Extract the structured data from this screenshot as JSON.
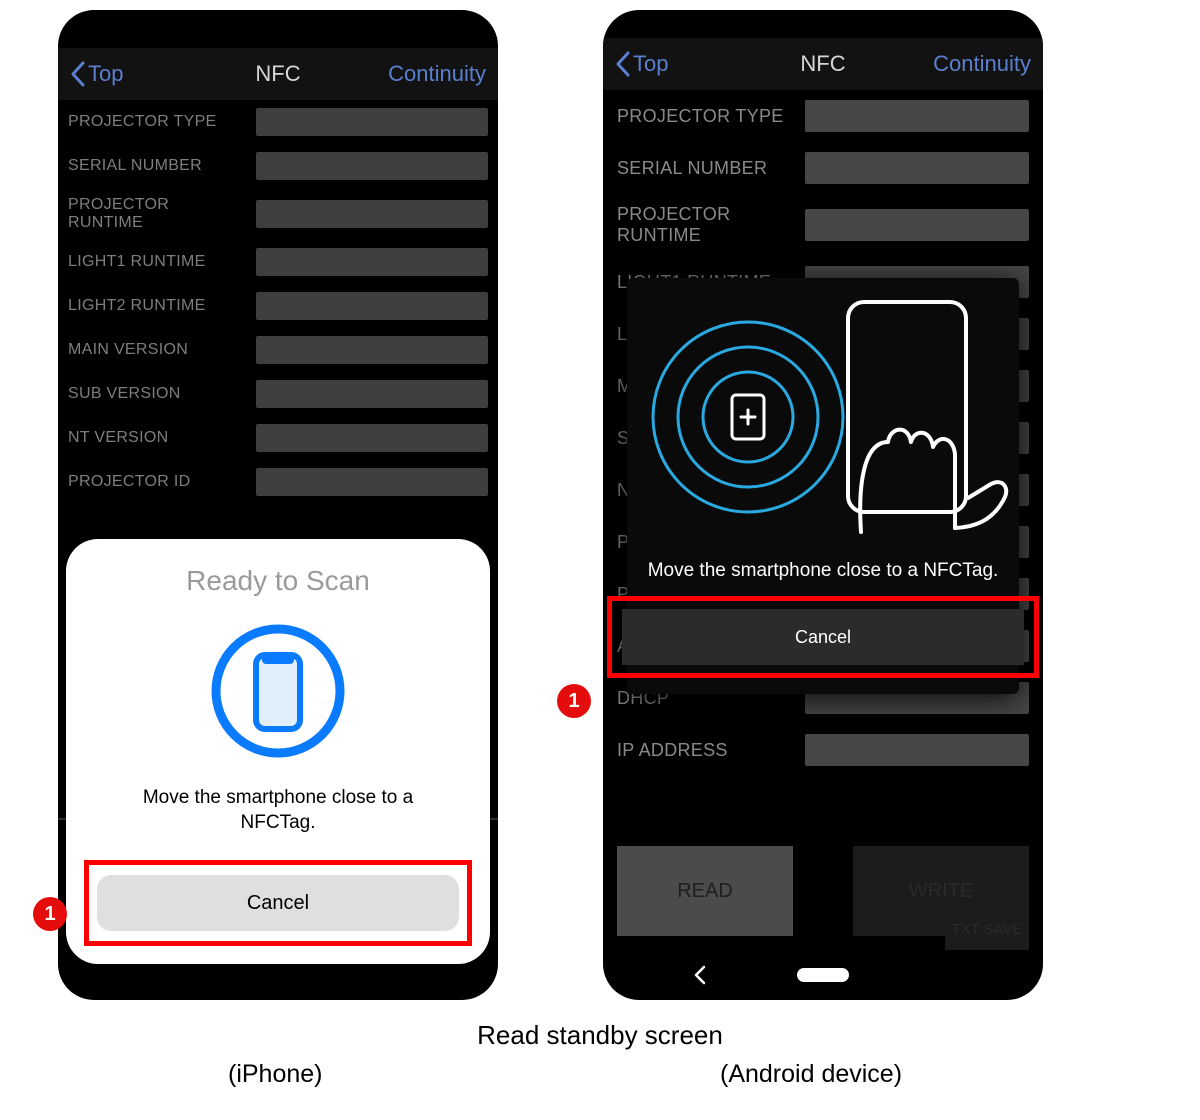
{
  "header": {
    "back_label": "Top",
    "title": "NFC",
    "right_link": "Continuity"
  },
  "fields": [
    "PROJECTOR TYPE",
    "SERIAL NUMBER",
    "PROJECTOR RUNTIME",
    "LIGHT1 RUNTIME",
    "LIGHT2 RUNTIME",
    "MAIN VERSION",
    "SUB VERSION",
    "NT VERSION",
    "PROJECTOR ID"
  ],
  "fields_android_extra": [
    "PROJECTOR NAME",
    "ASSIGNED NAME",
    "DHCP",
    "IP ADDRESS"
  ],
  "android_buttons": {
    "read": "READ",
    "write": "WRITE",
    "txt_save": "TXT SAVE"
  },
  "ios_overlay": {
    "title": "Ready to Scan",
    "instruction": "Move the smartphone close to a NFCTag.",
    "cancel": "Cancel"
  },
  "android_overlay": {
    "instruction": "Move the smartphone close to a NFCTag.",
    "cancel": "Cancel"
  },
  "callout": {
    "number": "1"
  },
  "captions": {
    "main": "Read standby screen",
    "left": "(iPhone)",
    "right": "(Android device)"
  }
}
